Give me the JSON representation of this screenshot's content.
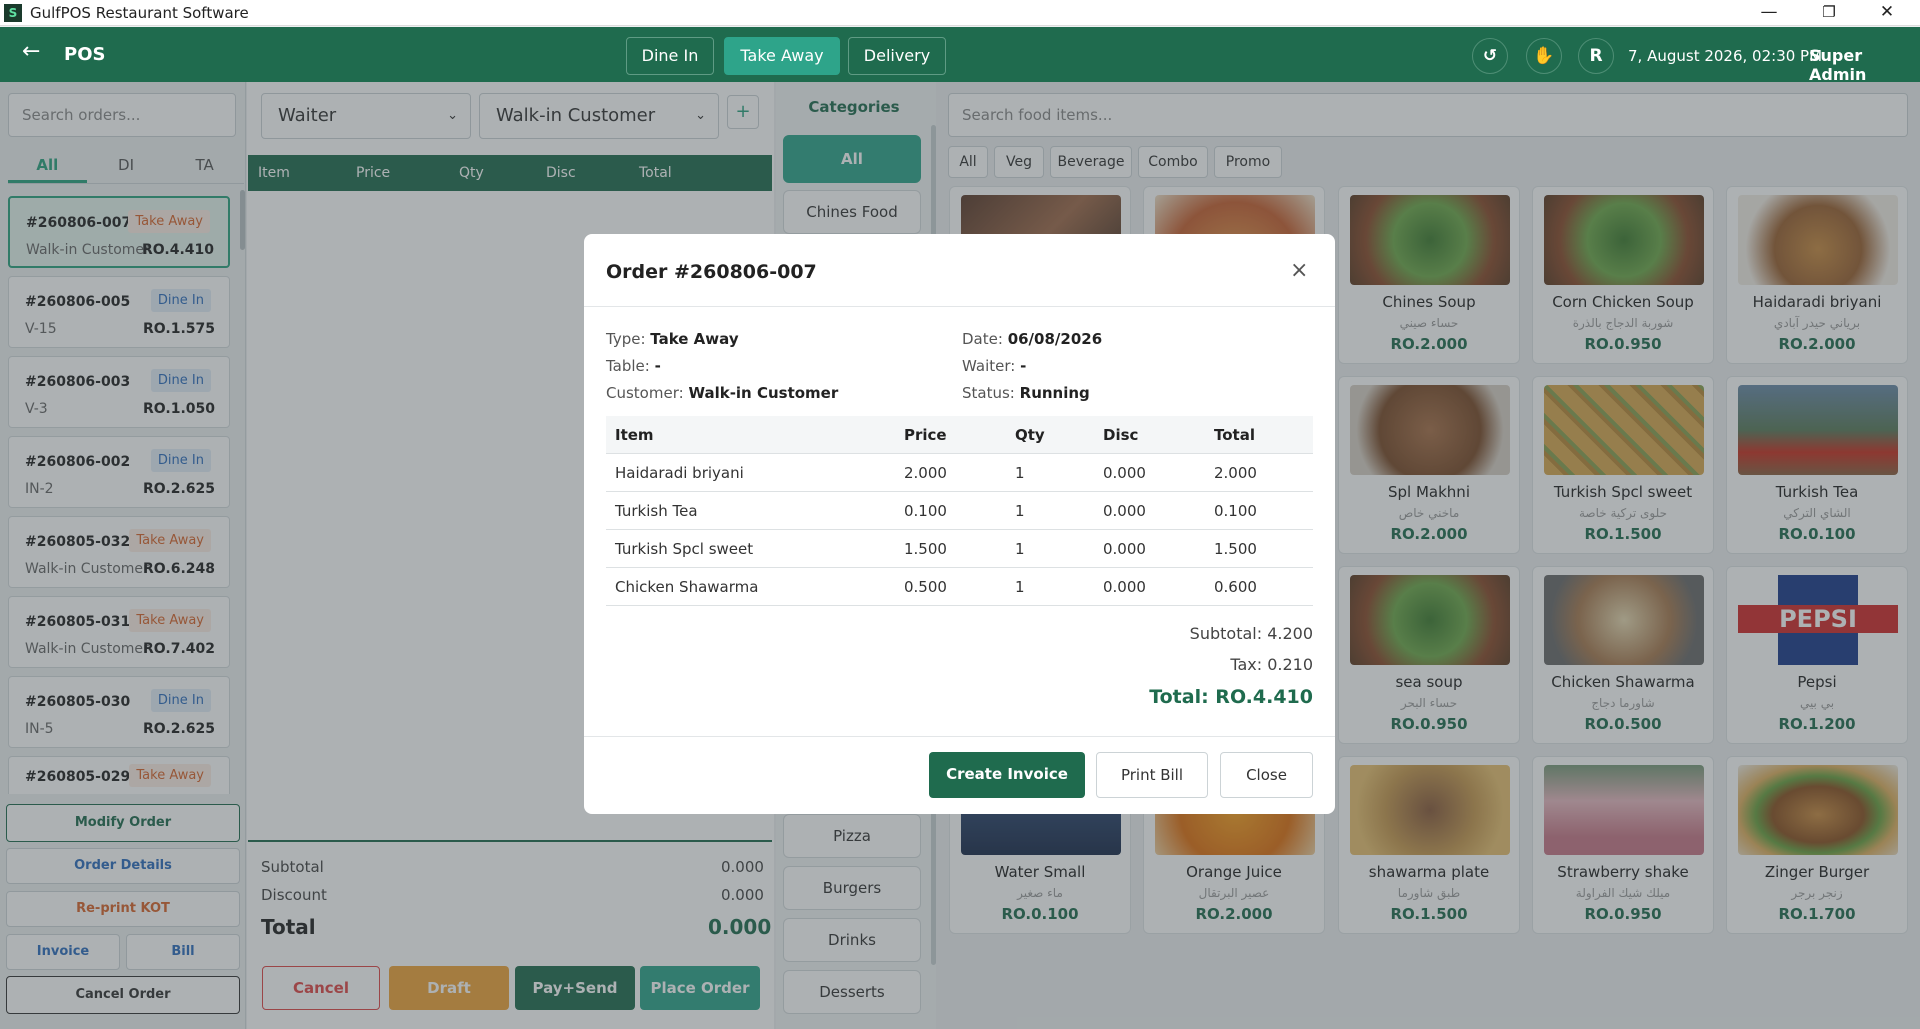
{
  "window": {
    "title": "GulfPOS Restaurant Software",
    "logo": "S",
    "min": "—",
    "restore": "❐",
    "close": "✕"
  },
  "header": {
    "back": "←",
    "title": "POS",
    "tabs": [
      "Dine In",
      "Take Away",
      "Delivery"
    ],
    "active_tab": "Take Away",
    "icons": {
      "refresh": "↺",
      "hand": "✋",
      "user": "R"
    },
    "datetime": "7, August 2026, 02:30 PM",
    "user": "Super Admin"
  },
  "orders": {
    "search_placeholder": "Search orders...",
    "tabs": [
      "All",
      "DI",
      "TA"
    ],
    "list": [
      {
        "id": "#260806-007",
        "type": "Take Away",
        "customer": "Walk-in Customer",
        "amount": "RO.4.410"
      },
      {
        "id": "#260806-005",
        "type": "Dine In",
        "customer": "V-15",
        "amount": "RO.1.575"
      },
      {
        "id": "#260806-003",
        "type": "Dine In",
        "customer": "V-3",
        "amount": "RO.1.050"
      },
      {
        "id": "#260806-002",
        "type": "Dine In",
        "customer": "IN-2",
        "amount": "RO.2.625"
      },
      {
        "id": "#260805-032",
        "type": "Take Away",
        "customer": "Walk-in Customer",
        "amount": "RO.6.248"
      },
      {
        "id": "#260805-031",
        "type": "Take Away",
        "customer": "Walk-in Customer",
        "amount": "RO.7.402"
      },
      {
        "id": "#260805-030",
        "type": "Dine In",
        "customer": "IN-5",
        "amount": "RO.2.625"
      },
      {
        "id": "#260805-029",
        "type": "Take Away",
        "customer": "",
        "amount": ""
      }
    ],
    "buttons": {
      "modify": "Modify Order",
      "details": "Order Details",
      "reprint": "Re-print KOT",
      "invoice": "Invoice",
      "bill": "Bill",
      "cancel": "Cancel Order"
    }
  },
  "cart": {
    "waiter": "Waiter",
    "customer": "Walk-in Customer",
    "add": "+",
    "columns": [
      "Item",
      "Price",
      "Qty",
      "Disc",
      "Total"
    ],
    "subtotal_label": "Subtotal",
    "subtotal": "0.000",
    "discount_label": "Discount",
    "discount": "0.000",
    "total_label": "Total",
    "total": "0.000",
    "buttons": {
      "cancel": "Cancel",
      "draft": "Draft",
      "pay_send": "Pay+Send",
      "place": "Place Order"
    }
  },
  "categories": {
    "title": "Categories",
    "items": [
      "All",
      "Chines Food",
      "Pizza",
      "Burgers",
      "Drinks",
      "Desserts"
    ]
  },
  "food": {
    "search_placeholder": "Search food items...",
    "filters": [
      "All",
      "Veg",
      "Beverage",
      "Combo",
      "Promo"
    ],
    "items": [
      {
        "name": "Chines Soup",
        "ar": "حساء صيني",
        "price": "RO.2.000"
      },
      {
        "name": "Corn Chicken Soup",
        "ar": "شوربة الدجاج بالذرة",
        "price": "RO.0.950"
      },
      {
        "name": "Haidaradi briyani",
        "ar": "برياني حيدر آبادي",
        "price": "RO.2.000"
      },
      {
        "name": "Spl Makhni",
        "ar": "ماخني خاص",
        "price": "RO.2.000"
      },
      {
        "name": "Turkish Spcl sweet",
        "ar": "حلوى تركية خاصة",
        "price": "RO.1.500"
      },
      {
        "name": "Turkish Tea",
        "ar": "الشاي التركي",
        "price": "RO.0.100"
      },
      {
        "name": "sea soup",
        "ar": "حساء البحر",
        "price": "RO.0.950"
      },
      {
        "name": "Chicken Shawarma",
        "ar": "شاورما دجاج",
        "price": "RO.0.500"
      },
      {
        "name": "Pepsi",
        "ar": "بي بيي",
        "price": "RO.1.200"
      },
      {
        "name": "Water Small",
        "ar": "ماء صغير",
        "price": "RO.0.100"
      },
      {
        "name": "Orange Juice",
        "ar": "عصير البرتقال",
        "price": "RO.2.000"
      },
      {
        "name": "shawarma plate",
        "ar": "طبق شاورما",
        "price": "RO.1.500"
      },
      {
        "name": "Strawberry shake",
        "ar": "ميلك شيك الفراولة",
        "price": "RO.0.950"
      },
      {
        "name": "Zinger Burger",
        "ar": "زنجر برجر",
        "price": "RO.1.700"
      }
    ]
  },
  "modal": {
    "title": "Order #260806-007",
    "close": "×",
    "type_label": "Type:",
    "type": "Take Away",
    "table_label": "Table:",
    "table": "-",
    "customer_label": "Customer:",
    "customer": "Walk-in Customer",
    "date_label": "Date:",
    "date": "06/08/2026",
    "waiter_label": "Waiter:",
    "waiter": "-",
    "status_label": "Status:",
    "status": "Running",
    "columns": [
      "Item",
      "Price",
      "Qty",
      "Disc",
      "Total"
    ],
    "rows": [
      [
        "Haidaradi briyani",
        "2.000",
        "1",
        "0.000",
        "2.000"
      ],
      [
        "Turkish Tea",
        "0.100",
        "1",
        "0.000",
        "0.100"
      ],
      [
        "Turkish Spcl sweet",
        "1.500",
        "1",
        "0.000",
        "1.500"
      ],
      [
        "Chicken Shawarma",
        "0.500",
        "1",
        "0.000",
        "0.600"
      ]
    ],
    "subtotal": "Subtotal: 4.200",
    "tax": "Tax: 0.210",
    "total": "Total: RO.4.410",
    "buttons": {
      "create": "Create Invoice",
      "print": "Print Bill",
      "close": "Close"
    }
  },
  "colors": {
    "primary": "#1f6b4e",
    "accent": "#2ea48a",
    "takeaway": "#d9652b",
    "dinein": "#2e6dbd",
    "draft": "#f0a43a",
    "cancel": "#e04848"
  }
}
